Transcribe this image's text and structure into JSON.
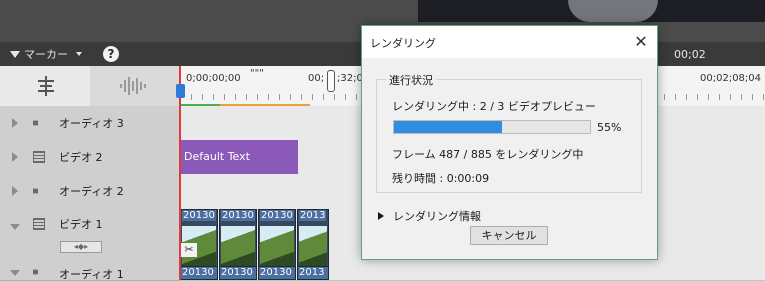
{
  "toolbar": {
    "marker_label": "マーカー",
    "right_timecode": "00;02"
  },
  "ruler": {
    "timecode_start": "0;00;00;00",
    "timecode_mid": "00;",
    "timecode_mid2": ";32;0",
    "timecode_end": "00;02;08;04"
  },
  "tracks": [
    {
      "label": "オーディオ 3",
      "type": "audio"
    },
    {
      "label": "ビデオ 2",
      "type": "video"
    },
    {
      "label": "オーディオ 2",
      "type": "audio"
    },
    {
      "label": "ビデオ 1",
      "type": "video"
    },
    {
      "label": "オーディオ 1",
      "type": "audio"
    }
  ],
  "clips": {
    "title_clip": "Default Text",
    "video_clips": [
      "20130",
      "20130",
      "20130",
      "2013"
    ],
    "audio_clips": [
      "20130",
      "20130",
      "20130",
      "2013"
    ]
  },
  "dialog": {
    "title": "レンダリング",
    "group_label": "進行状況",
    "status": "レンダリング中 : 2 / 3 ビデオプレビュー",
    "progress_fraction": 0.55,
    "progress_percent": "55%",
    "frames": "フレーム 487 / 885 をレンダリング中",
    "remaining": "残り時間 : 0:00:09",
    "details_label": "レンダリング情報",
    "cancel_label": "キャンセル"
  },
  "colors": {
    "accent": "#2f8ee0",
    "title_clip": "#8b59b8",
    "playhead": "#e03a3a",
    "dialog_border": "#5aa67a"
  }
}
